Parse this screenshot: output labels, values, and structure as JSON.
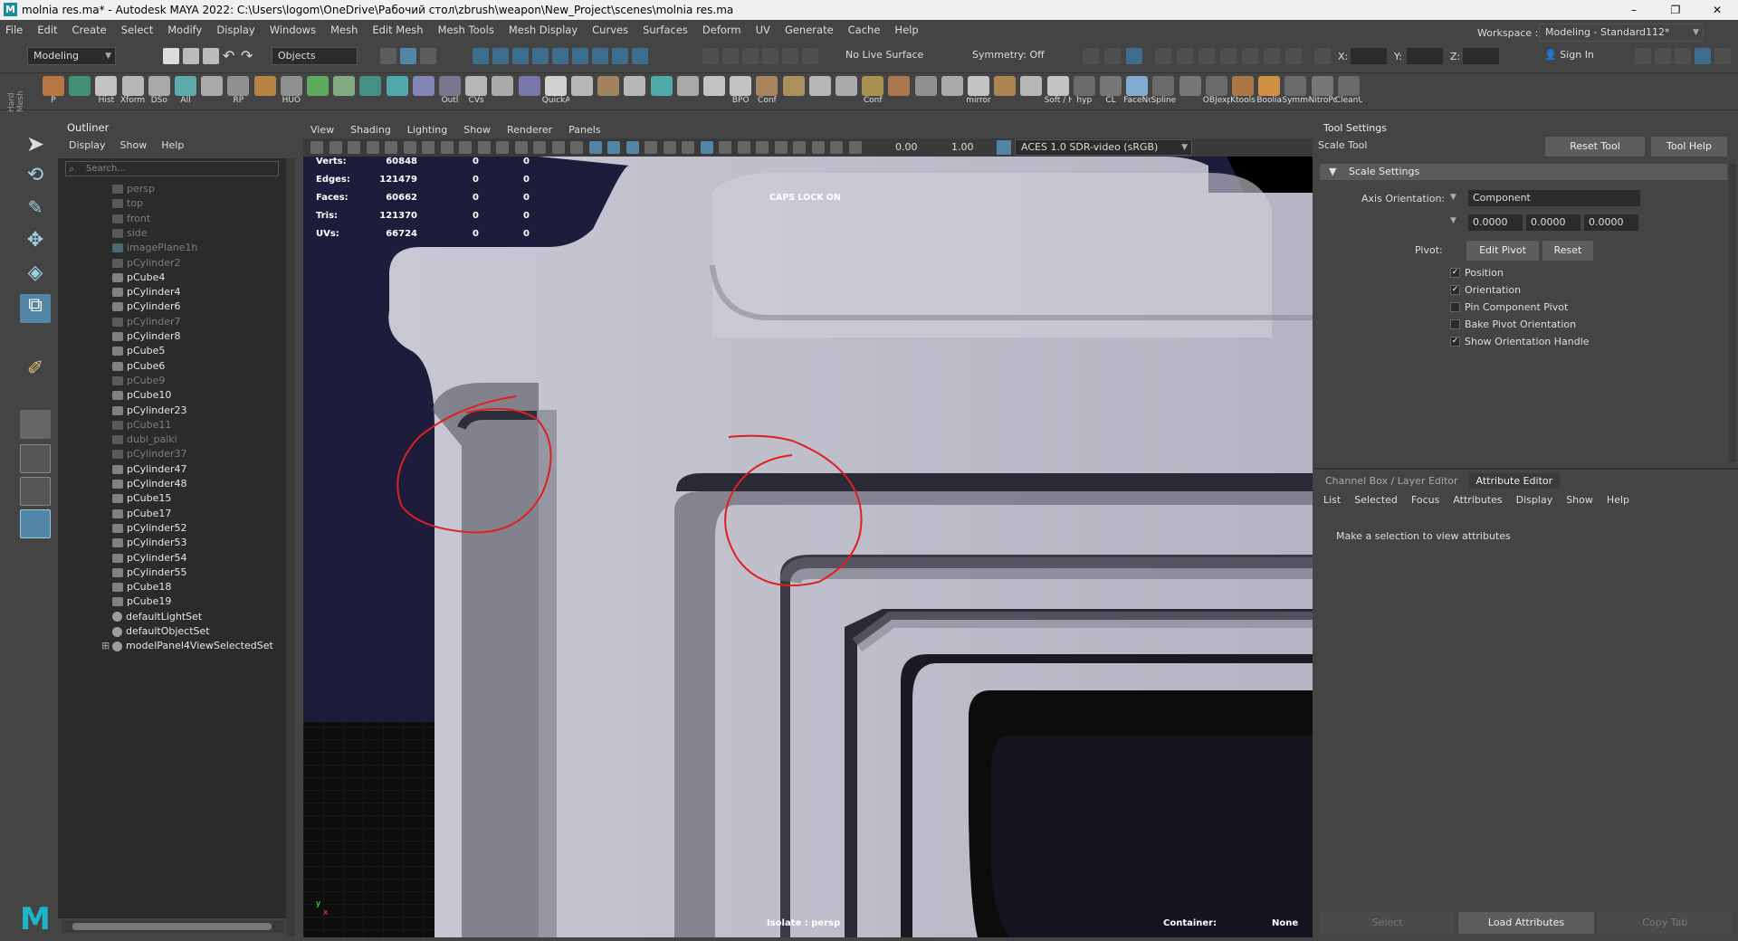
{
  "window": {
    "title": "molnia res.ma* - Autodesk MAYA 2022: C:\\Users\\logom\\OneDrive\\Рабочий стол\\zbrush\\weapon\\New_Project\\scenes\\molnia res.ma",
    "logo": "M",
    "minimize": "–",
    "restore": "❐",
    "close": "✕"
  },
  "menubar": [
    "File",
    "Edit",
    "Create",
    "Select",
    "Modify",
    "Display",
    "Windows",
    "Mesh",
    "Edit Mesh",
    "Mesh Tools",
    "Mesh Display",
    "Curves",
    "Surfaces",
    "Deform",
    "UV",
    "Generate",
    "Cache",
    "Help"
  ],
  "statusline": {
    "menuset": "Modeling",
    "selection_mode": "Objects",
    "live_surface": "No Live Surface",
    "symmetry": "Symmetry: Off",
    "x_label": "X:",
    "y_label": "Y:",
    "z_label": "Z:",
    "sign_in": "Sign In",
    "workspace_label": "Workspace :",
    "workspace": "Modeling - Standard112*"
  },
  "shelf_tab": "Hard Mesh",
  "shelf": [
    "P",
    "",
    "Hist",
    "Xform",
    "DSo",
    "All",
    "",
    "RP",
    "",
    "HUO",
    "",
    "",
    "",
    "",
    "",
    "Outl",
    "CVs",
    "",
    "",
    "QuickAl",
    "",
    "",
    "",
    "",
    "",
    "",
    "BPO",
    "Conf",
    "",
    "",
    "",
    "Conf",
    "",
    "",
    "",
    "mirror",
    "",
    "",
    "Soft / H",
    "hyp",
    "CL",
    "FaceNo",
    "Spline",
    "",
    "OBJexp",
    "Ktools",
    "Boolia",
    "Symme",
    "NitroPo",
    "CleanU"
  ],
  "outliner": {
    "title": "Outliner",
    "menus": [
      "Display",
      "Show",
      "Help"
    ],
    "search_placeholder": "Search...",
    "items": [
      {
        "name": "persp",
        "dim": true,
        "type": "camera"
      },
      {
        "name": "top",
        "dim": true,
        "type": "camera"
      },
      {
        "name": "front",
        "dim": true,
        "type": "camera"
      },
      {
        "name": "side",
        "dim": true,
        "type": "camera"
      },
      {
        "name": "imagePlane1h",
        "dim": true,
        "type": "image"
      },
      {
        "name": "pCylinder2",
        "dim": true,
        "type": "mesh"
      },
      {
        "name": "pCube4",
        "dim": false,
        "type": "mesh"
      },
      {
        "name": "pCylinder4",
        "dim": false,
        "type": "mesh"
      },
      {
        "name": "pCylinder6",
        "dim": false,
        "type": "mesh"
      },
      {
        "name": "pCylinder7",
        "dim": true,
        "type": "mesh"
      },
      {
        "name": "pCylinder8",
        "dim": false,
        "type": "mesh"
      },
      {
        "name": "pCube5",
        "dim": false,
        "type": "mesh"
      },
      {
        "name": "pCube6",
        "dim": false,
        "type": "mesh"
      },
      {
        "name": "pCube9",
        "dim": true,
        "type": "mesh"
      },
      {
        "name": "pCube10",
        "dim": false,
        "type": "mesh"
      },
      {
        "name": "pCylinder23",
        "dim": false,
        "type": "mesh"
      },
      {
        "name": "pCube11",
        "dim": true,
        "type": "mesh"
      },
      {
        "name": "dubl_palki",
        "dim": true,
        "type": "mesh"
      },
      {
        "name": "pCylinder37",
        "dim": true,
        "type": "mesh"
      },
      {
        "name": "pCylinder47",
        "dim": false,
        "type": "mesh"
      },
      {
        "name": "pCylinder48",
        "dim": false,
        "type": "mesh"
      },
      {
        "name": "pCube15",
        "dim": false,
        "type": "mesh"
      },
      {
        "name": "pCube17",
        "dim": false,
        "type": "mesh"
      },
      {
        "name": "pCylinder52",
        "dim": false,
        "type": "mesh"
      },
      {
        "name": "pCylinder53",
        "dim": false,
        "type": "mesh"
      },
      {
        "name": "pCylinder54",
        "dim": false,
        "type": "mesh"
      },
      {
        "name": "pCylinder55",
        "dim": false,
        "type": "mesh"
      },
      {
        "name": "pCube18",
        "dim": false,
        "type": "mesh"
      },
      {
        "name": "pCube19",
        "dim": false,
        "type": "mesh"
      },
      {
        "name": "defaultLightSet",
        "dim": false,
        "type": "set"
      },
      {
        "name": "defaultObjectSet",
        "dim": false,
        "type": "set"
      },
      {
        "name": "modelPanel4ViewSelectedSet",
        "dim": false,
        "type": "set",
        "expander": "⊞"
      }
    ]
  },
  "viewport": {
    "menus": [
      "View",
      "Shading",
      "Lighting",
      "Show",
      "Renderer",
      "Panels"
    ],
    "exposure": "0.00",
    "gamma": "1.00",
    "colorspace": "ACES 1.0 SDR-video (sRGB)",
    "hud": [
      {
        "label": "Verts:",
        "v1": "60848",
        "v2": "0",
        "v3": "0"
      },
      {
        "label": "Edges:",
        "v1": "121479",
        "v2": "0",
        "v3": "0"
      },
      {
        "label": "Faces:",
        "v1": "60662",
        "v2": "0",
        "v3": "0"
      },
      {
        "label": "Tris:",
        "v1": "121370",
        "v2": "0",
        "v3": "0"
      },
      {
        "label": "UVs:",
        "v1": "66724",
        "v2": "0",
        "v3": "0"
      }
    ],
    "caps_lock": "CAPS LOCK ON",
    "isolate": "Isolate : persp",
    "container_label": "Container:",
    "container_value": "None",
    "axis_y": "y",
    "axis_x": "x"
  },
  "tool_settings": {
    "title": "Tool Settings",
    "tool_name": "Scale Tool",
    "reset_tool": "Reset Tool",
    "tool_help": "Tool Help",
    "section": "Scale Settings",
    "axis_orientation_label": "Axis Orientation:",
    "axis_orientation": "Component",
    "vals": [
      "0.0000",
      "0.0000",
      "0.0000"
    ],
    "pivot_label": "Pivot:",
    "edit_pivot": "Edit Pivot",
    "reset": "Reset",
    "checks": [
      {
        "label": "Position",
        "checked": true
      },
      {
        "label": "Orientation",
        "checked": true
      },
      {
        "label": "Pin Component Pivot",
        "checked": false
      },
      {
        "label": "Bake Pivot Orientation",
        "checked": false
      },
      {
        "label": "Show Orientation Handle",
        "checked": true
      }
    ]
  },
  "attribute_editor": {
    "tabs": [
      "Channel Box / Layer Editor",
      "Attribute Editor"
    ],
    "menus": [
      "List",
      "Selected",
      "Focus",
      "Attributes",
      "Display",
      "Show",
      "Help"
    ],
    "empty_text": "Make a selection to view attributes",
    "buttons": [
      "Select",
      "Load Attributes",
      "Copy Tab"
    ]
  },
  "colors": {
    "accent": "#5285a6",
    "annotation": "#e02020",
    "mesh": "#b8b8c6",
    "bg": "#1b1a38"
  }
}
